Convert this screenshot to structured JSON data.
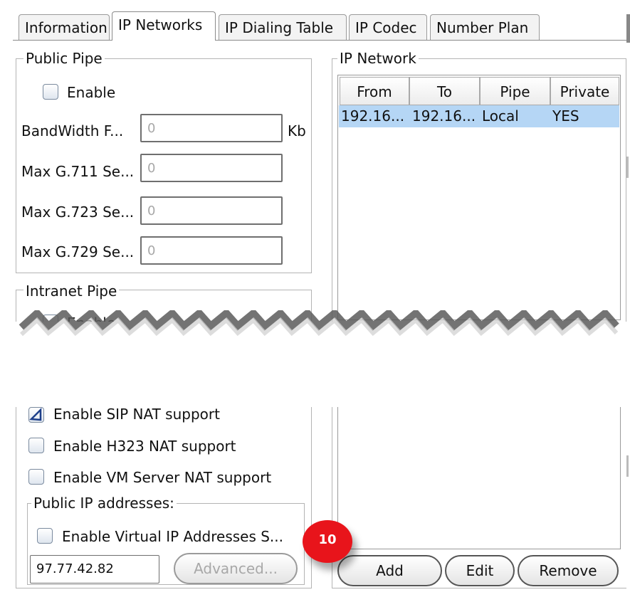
{
  "tabs": [
    {
      "label": "Information",
      "active": false
    },
    {
      "label": "IP Networks",
      "active": true
    },
    {
      "label": "IP Dialing Table",
      "active": false
    },
    {
      "label": "IP Codec",
      "active": false
    },
    {
      "label": "Number Plan",
      "active": false
    }
  ],
  "public_pipe": {
    "title": "Public Pipe",
    "enable_label": "Enable",
    "enable_checked": false,
    "fields": [
      {
        "label": "BandWidth F...",
        "value": "0",
        "unit": "Kb"
      },
      {
        "label": "Max G.711 Se...",
        "value": "0"
      },
      {
        "label": "Max G.723 Se...",
        "value": "0"
      },
      {
        "label": "Max G.729 Se...",
        "value": "0"
      }
    ]
  },
  "intranet_pipe": {
    "title": "Intranet Pipe",
    "enable_label": "Enable"
  },
  "nat": {
    "sip_nat_label": "Enable SIP NAT support",
    "sip_nat_checked": true,
    "h323_nat_label": "Enable H323 NAT support",
    "h323_nat_checked": false,
    "vm_nat_label": "Enable VM Server NAT support",
    "vm_nat_checked": false
  },
  "public_ip": {
    "title": "Public IP addresses:",
    "virtual_label": "Enable Virtual IP Addresses S...",
    "virtual_checked": false,
    "ip_value": "97.77.42.82",
    "advanced_label": "Advanced..."
  },
  "ip_network": {
    "title": "IP Network",
    "columns": [
      "From",
      "To",
      "Pipe",
      "Private"
    ],
    "rows": [
      {
        "from": "192.16...",
        "to": "192.16...",
        "pipe": "Local",
        "private": "YES",
        "selected": true
      }
    ],
    "buttons": {
      "add": "Add",
      "edit": "Edit",
      "remove": "Remove"
    }
  },
  "marker": {
    "label": "10",
    "color": "#e8141b"
  }
}
